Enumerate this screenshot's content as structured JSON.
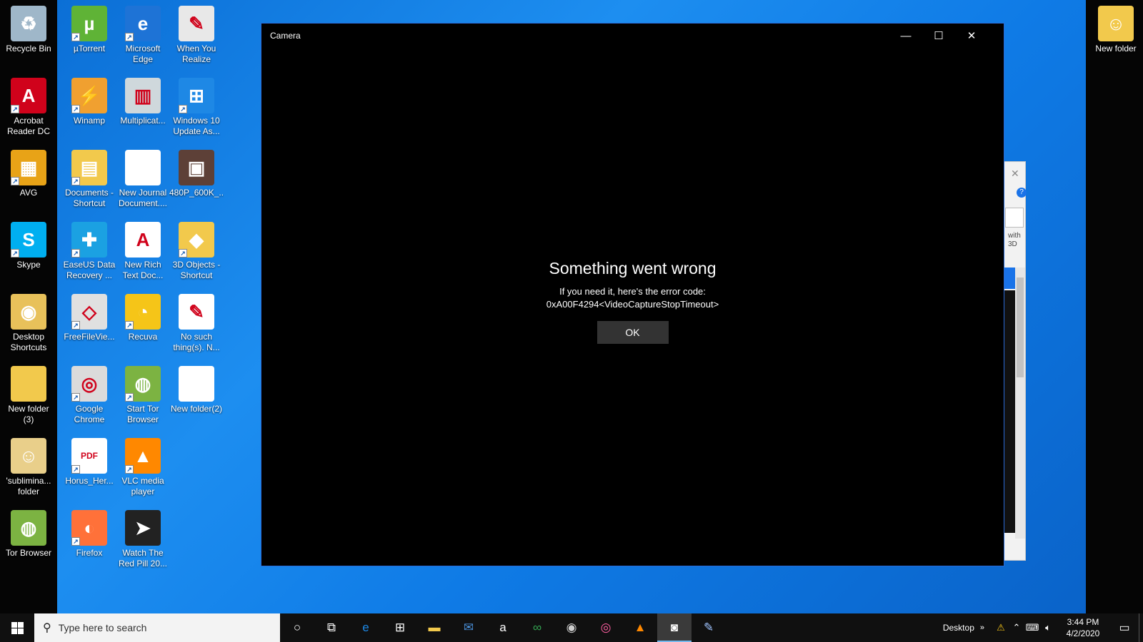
{
  "desktop": {
    "left_column": [
      {
        "name": "recycle-bin",
        "label": "Recycle Bin",
        "icon": "recycle-bin-icon",
        "color": "#9fb7c9",
        "glyph": "♻",
        "shortcut": false
      },
      {
        "name": "acrobat",
        "label": "Acrobat\nReader DC",
        "icon": "acrobat-icon",
        "color": "#d0021b",
        "glyph": "A",
        "shortcut": true
      },
      {
        "name": "avg",
        "label": "AVG",
        "icon": "avg-icon",
        "color": "#e8a317",
        "glyph": "▦",
        "shortcut": true
      },
      {
        "name": "skype",
        "label": "Skype",
        "icon": "skype-icon",
        "color": "#00aff0",
        "glyph": "S",
        "shortcut": true
      },
      {
        "name": "desktop-shortcuts",
        "label": "Desktop\nShortcuts",
        "icon": "folder-icon",
        "color": "#e8c15a",
        "glyph": "◉",
        "shortcut": false
      },
      {
        "name": "new-folder-3",
        "label": "New folder\n(3)",
        "icon": "folder-icon",
        "color": "#f2c94c",
        "glyph": "",
        "shortcut": false
      },
      {
        "name": "subliminal-folder",
        "label": "'sublimina...\nfolder",
        "icon": "folder-icon",
        "color": "#e9cf8a",
        "glyph": "☺",
        "shortcut": false
      },
      {
        "name": "tor-browser-folder",
        "label": "Tor Browser",
        "icon": "tor-folder-icon",
        "color": "#7cb342",
        "glyph": "◍",
        "shortcut": false
      }
    ],
    "column_2": [
      {
        "name": "utorrent",
        "label": "µTorrent",
        "icon": "utorrent-icon",
        "color": "#5fb336",
        "glyph": "µ",
        "shortcut": true
      },
      {
        "name": "winamp",
        "label": "Winamp",
        "icon": "winamp-icon",
        "color": "#f0a030",
        "glyph": "⚡",
        "shortcut": true
      },
      {
        "name": "documents-shortcut",
        "label": "Documents -\nShortcut",
        "icon": "documents-folder-icon",
        "color": "#f2c94c",
        "glyph": "▤",
        "shortcut": true
      },
      {
        "name": "easeus",
        "label": "EaseUS Data\nRecovery ...",
        "icon": "easeus-icon",
        "color": "#1ba1e2",
        "glyph": "✚",
        "shortcut": true
      },
      {
        "name": "freefileviewer",
        "label": "FreeFileVie...",
        "icon": "freefileviewer-icon",
        "color": "#e0e0e0",
        "glyph": "◇",
        "shortcut": true
      },
      {
        "name": "google-chrome",
        "label": "Google\nChrome",
        "icon": "chrome-icon",
        "color": "#dbdbdb",
        "glyph": "◎",
        "shortcut": true
      },
      {
        "name": "horus-pdf",
        "label": "Horus_Her...",
        "icon": "pdf-icon",
        "color": "#ffffff",
        "glyph": "PDF",
        "shortcut": true
      },
      {
        "name": "firefox",
        "label": "Firefox",
        "icon": "firefox-icon",
        "color": "#ff7139",
        "glyph": "◐",
        "shortcut": true
      }
    ],
    "column_3": [
      {
        "name": "microsoft-edge",
        "label": "Microsoft\nEdge",
        "icon": "edge-icon",
        "color": "#1e73d6",
        "glyph": "e",
        "shortcut": true
      },
      {
        "name": "multiplicat",
        "label": "Multiplicat...",
        "icon": "book-icon",
        "color": "#cfd8dc",
        "glyph": "▥",
        "shortcut": false
      },
      {
        "name": "new-journal-document",
        "label": "New Journal\nDocument....",
        "icon": "document-icon",
        "color": "#ffffff",
        "glyph": "",
        "shortcut": false
      },
      {
        "name": "new-rich-text-doc",
        "label": "New Rich\nText Doc...",
        "icon": "rich-text-icon",
        "color": "#ffffff",
        "glyph": "A",
        "shortcut": false
      },
      {
        "name": "recuva",
        "label": "Recuva",
        "icon": "recuva-icon",
        "color": "#f5c518",
        "glyph": "◔",
        "shortcut": true
      },
      {
        "name": "start-tor-browser",
        "label": "Start Tor\nBrowser",
        "icon": "tor-icon",
        "color": "#7cb342",
        "glyph": "◍",
        "shortcut": true
      },
      {
        "name": "vlc-media-player",
        "label": "VLC media\nplayer",
        "icon": "vlc-icon",
        "color": "#ff8800",
        "glyph": "▲",
        "shortcut": true
      },
      {
        "name": "watch-the-red-pill",
        "label": "Watch The\nRed Pill 20...",
        "icon": "video-icon",
        "color": "#222222",
        "glyph": "➤",
        "shortcut": false
      }
    ],
    "column_4": [
      {
        "name": "when-you-realize",
        "label": "When You\nRealize",
        "icon": "gradient-icon",
        "color": "#e8e8e8",
        "glyph": "✎",
        "shortcut": false
      },
      {
        "name": "windows-10-update",
        "label": "Windows 10\nUpdate As...",
        "icon": "windows-update-icon",
        "color": "#1e88e5",
        "glyph": "⊞",
        "shortcut": true
      },
      {
        "name": "480p-video",
        "label": "480P_600K_...",
        "icon": "video-icon",
        "color": "#5d4037",
        "glyph": "▣",
        "shortcut": false
      },
      {
        "name": "3d-objects-shortcut",
        "label": "3D Objects -\nShortcut",
        "icon": "3d-objects-folder-icon",
        "color": "#f2c94c",
        "glyph": "◆",
        "shortcut": true
      },
      {
        "name": "no-such-thing",
        "label": "No such\nthing(s). N...",
        "icon": "script-icon",
        "color": "#ffffff",
        "glyph": "✎",
        "shortcut": false
      },
      {
        "name": "new-folder-2",
        "label": "New folder(2)",
        "icon": "document-icon",
        "color": "#ffffff",
        "glyph": "",
        "shortcut": false
      }
    ],
    "right_column": [
      {
        "name": "new-folder",
        "label": "New folder",
        "icon": "folder-icon",
        "color": "#f2c94c",
        "glyph": "☺",
        "shortcut": false
      }
    ]
  },
  "background_window": {
    "text": "with\n3D"
  },
  "camera_window": {
    "title": "Camera",
    "error_title": "Something went wrong",
    "error_line1": "If you need it, here's the error code:",
    "error_line2": "0xA00F4294<VideoCaptureStopTimeout>",
    "ok_label": "OK"
  },
  "taskbar": {
    "search_placeholder": "Type here to search",
    "apps": [
      {
        "name": "cortana",
        "icon": "cortana-icon",
        "glyph": "○",
        "color": "#ffffff",
        "active": false
      },
      {
        "name": "task-view",
        "icon": "task-view-icon",
        "glyph": "⧉",
        "color": "#ffffff",
        "active": false
      },
      {
        "name": "edge",
        "icon": "edge-icon",
        "glyph": "e",
        "color": "#1e88e5",
        "active": false
      },
      {
        "name": "store",
        "icon": "store-icon",
        "glyph": "⊞",
        "color": "#ffffff",
        "active": false
      },
      {
        "name": "file-explorer",
        "icon": "folder-icon",
        "glyph": "▬",
        "color": "#f2c94c",
        "active": false
      },
      {
        "name": "mail",
        "icon": "mail-icon",
        "glyph": "✉",
        "color": "#4a90d9",
        "active": false
      },
      {
        "name": "amazon",
        "icon": "amazon-icon",
        "glyph": "a",
        "color": "#ffffff",
        "active": false
      },
      {
        "name": "tripadvisor",
        "icon": "tripadvisor-icon",
        "glyph": "∞",
        "color": "#34a853",
        "active": false
      },
      {
        "name": "app-dark-circle",
        "icon": "circle-app-icon",
        "glyph": "◉",
        "color": "#cccccc",
        "active": false
      },
      {
        "name": "app-colorful",
        "icon": "color-wheel-icon",
        "glyph": "◎",
        "color": "#ff5fa2",
        "active": false
      },
      {
        "name": "vlc",
        "icon": "vlc-icon",
        "glyph": "▲",
        "color": "#ff8800",
        "active": false
      },
      {
        "name": "camera",
        "icon": "camera-icon",
        "glyph": "◙",
        "color": "#ffffff",
        "active": true
      },
      {
        "name": "paint",
        "icon": "paint-icon",
        "glyph": "✎",
        "color": "#a0c4ff",
        "active": false
      }
    ],
    "desktop_label": "Desktop",
    "time": "3:44 PM",
    "date": "4/2/2020"
  }
}
